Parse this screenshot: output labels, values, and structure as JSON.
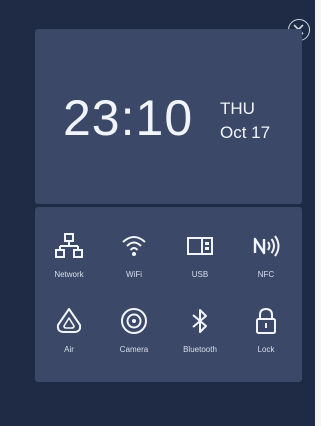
{
  "clock": {
    "time": "23:10",
    "day": "THU",
    "date": "Oct 17"
  },
  "tiles": [
    {
      "label": "Network",
      "icon": "network-icon"
    },
    {
      "label": "WiFi",
      "icon": "wifi-icon"
    },
    {
      "label": "USB",
      "icon": "usb-icon"
    },
    {
      "label": "NFC",
      "icon": "nfc-icon"
    },
    {
      "label": "Air",
      "icon": "air-icon"
    },
    {
      "label": "Camera",
      "icon": "camera-icon"
    },
    {
      "label": "Bluetooth",
      "icon": "bluetooth-icon"
    },
    {
      "label": "Lock",
      "icon": "lock-icon"
    }
  ],
  "colors": {
    "background": "#1f2a45",
    "panel": "#3b4868",
    "icon": "#f1f4fa"
  }
}
